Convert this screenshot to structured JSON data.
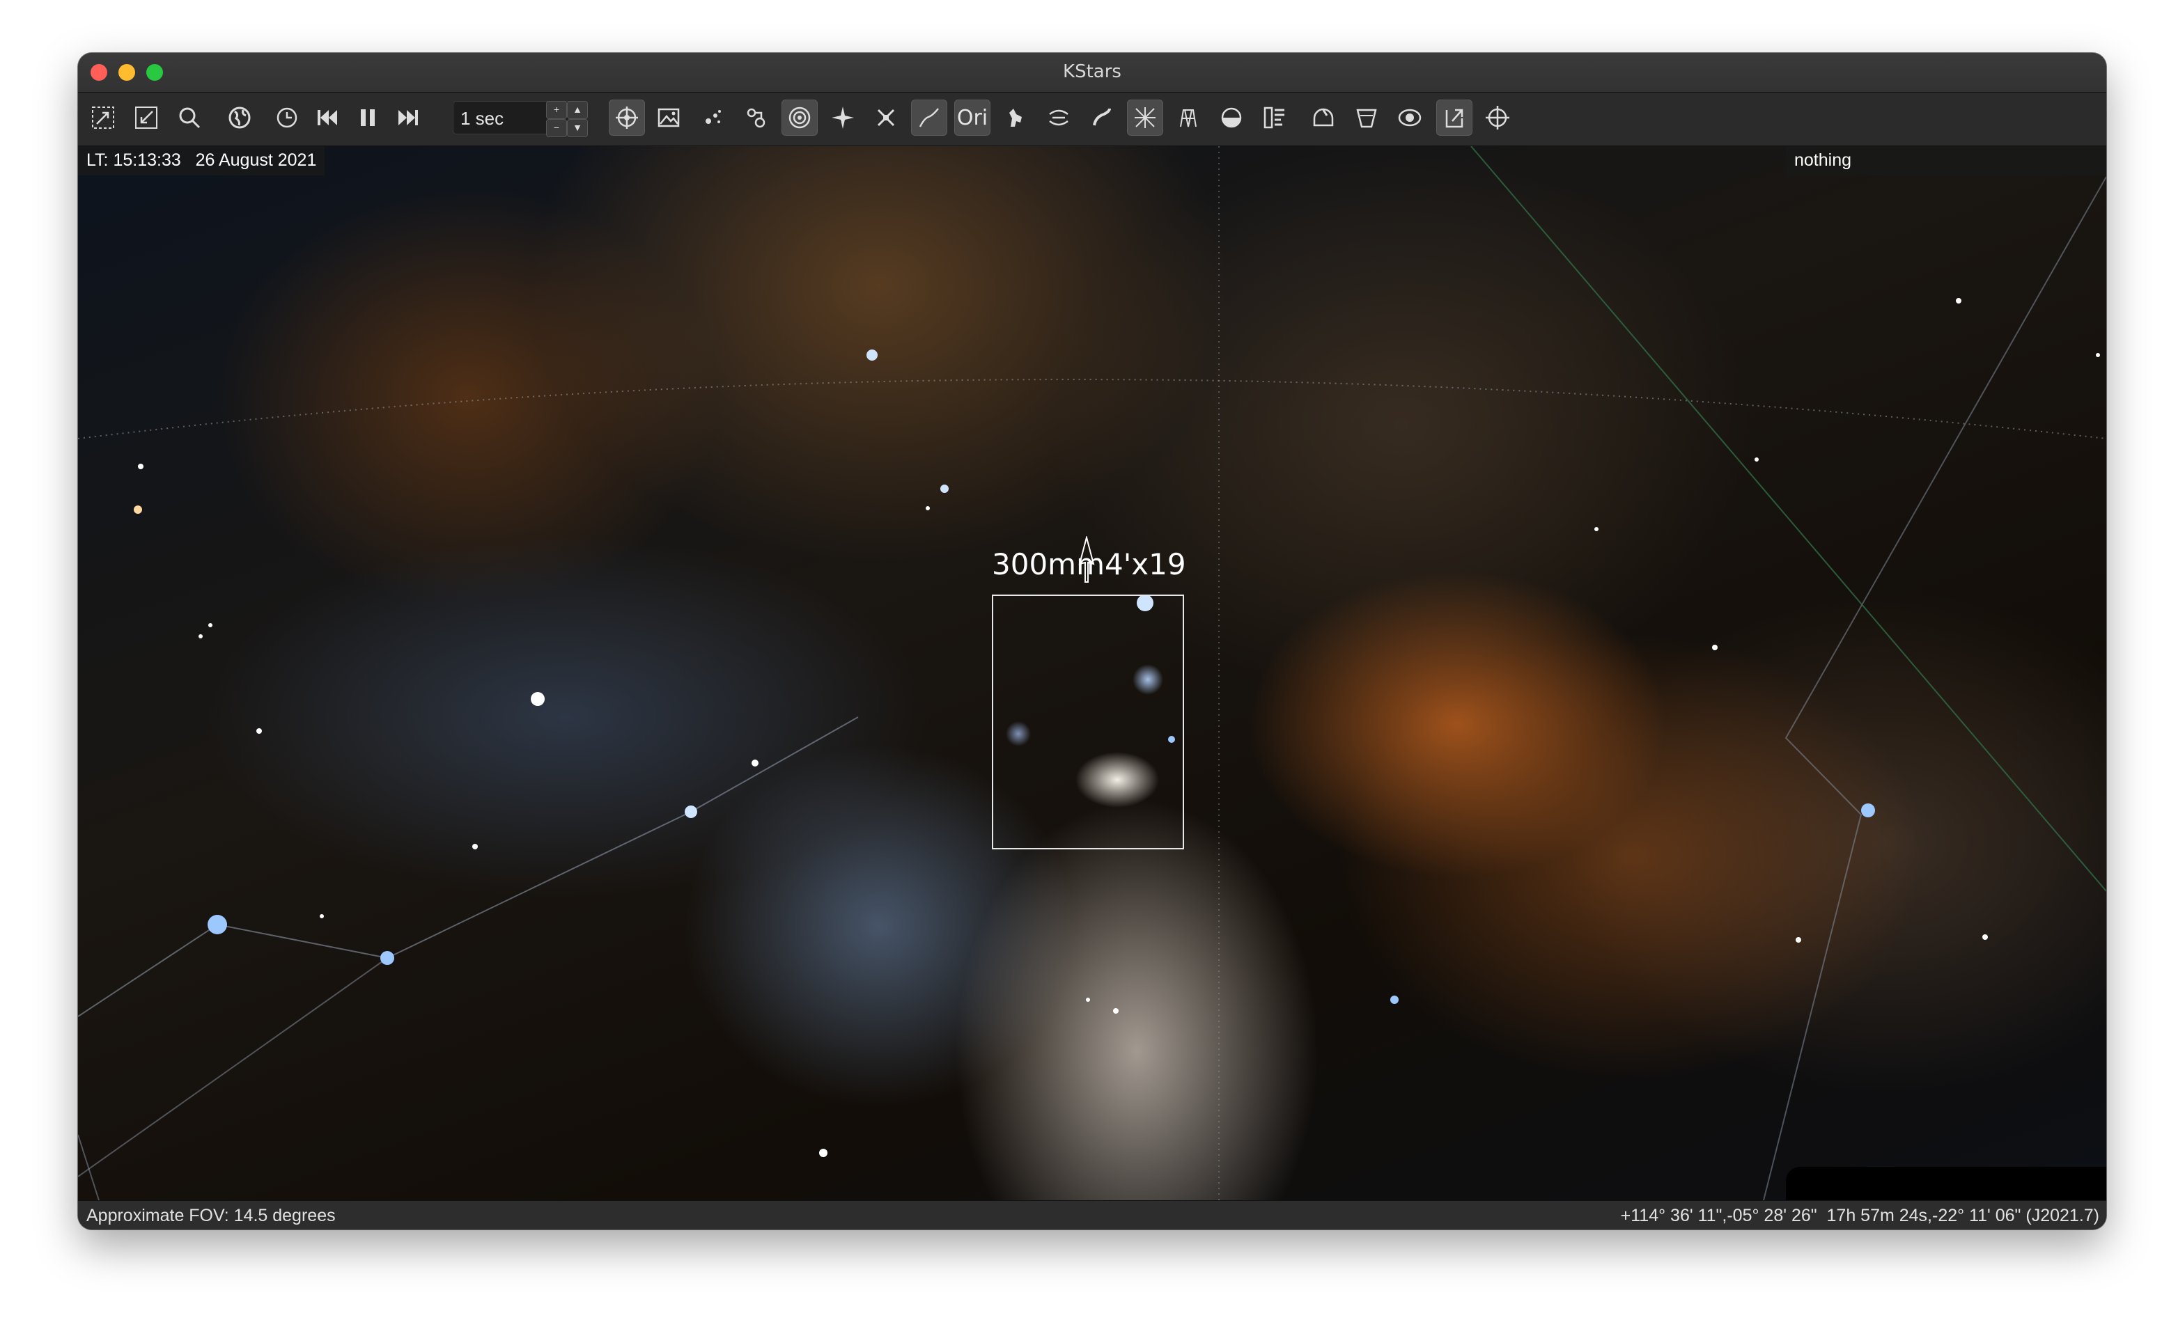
{
  "window": {
    "title": "KStars"
  },
  "toolbar": {
    "buttons": [
      {
        "icon": "zoom-in-icon",
        "active": false
      },
      {
        "icon": "zoom-out-icon",
        "active": false
      },
      {
        "icon": "search-icon",
        "active": false
      },
      {
        "icon": "globe-icon",
        "active": false
      },
      {
        "icon": "clock-icon",
        "active": false
      },
      {
        "icon": "step-backward-icon",
        "active": false
      },
      {
        "icon": "pause-icon",
        "active": false
      },
      {
        "icon": "step-forward-icon",
        "active": false
      },
      {
        "icon": "equatorial-coords-icon",
        "active": true
      },
      {
        "icon": "image-icon",
        "active": false
      },
      {
        "icon": "stars-icon",
        "active": false
      },
      {
        "icon": "deep-sky-icon",
        "active": false
      },
      {
        "icon": "target-icon",
        "active": true
      },
      {
        "icon": "sparkle-icon",
        "active": false
      },
      {
        "icon": "satellite-icon",
        "active": false
      },
      {
        "icon": "constellation-lines-icon",
        "active": true
      },
      {
        "icon": "constellation-names-icon",
        "active": true
      },
      {
        "icon": "constellation-art-icon",
        "active": false
      },
      {
        "icon": "milky-way-icon",
        "active": false
      },
      {
        "icon": "comet-icon",
        "active": false
      },
      {
        "icon": "grid-toggle-icon",
        "active": true
      },
      {
        "icon": "horizon-icon",
        "active": false
      },
      {
        "icon": "ground-icon",
        "active": false
      },
      {
        "icon": "panel-icon",
        "active": false
      },
      {
        "icon": "observatory-icon",
        "active": false
      },
      {
        "icon": "telescope-icon",
        "active": false
      },
      {
        "icon": "eye-icon",
        "active": false
      },
      {
        "icon": "export-icon",
        "active": true
      },
      {
        "icon": "crosshair-icon",
        "active": false
      }
    ],
    "ori_label": "Ori",
    "time_step": "1 sec"
  },
  "sky": {
    "local_time": "LT: 15:13:33   26 August 2021",
    "object_under_cursor": "nothing",
    "fov_label": "300mm4'x19",
    "fov_label_visible": "300mm4'x19"
  },
  "status": {
    "fov": "Approximate FOV: 14.5 degrees",
    "coords": "+114° 36' 11\",-05° 28' 26\"  17h 57m 24s,-22° 11' 06\" (J2021.7)"
  },
  "colors": {
    "titlebar": "#323232",
    "toolbar": "#2b2b2b",
    "close": "#ff5f57",
    "minimize": "#febc2e",
    "maximize": "#28c840",
    "constellation_line": "#8c96a8"
  }
}
